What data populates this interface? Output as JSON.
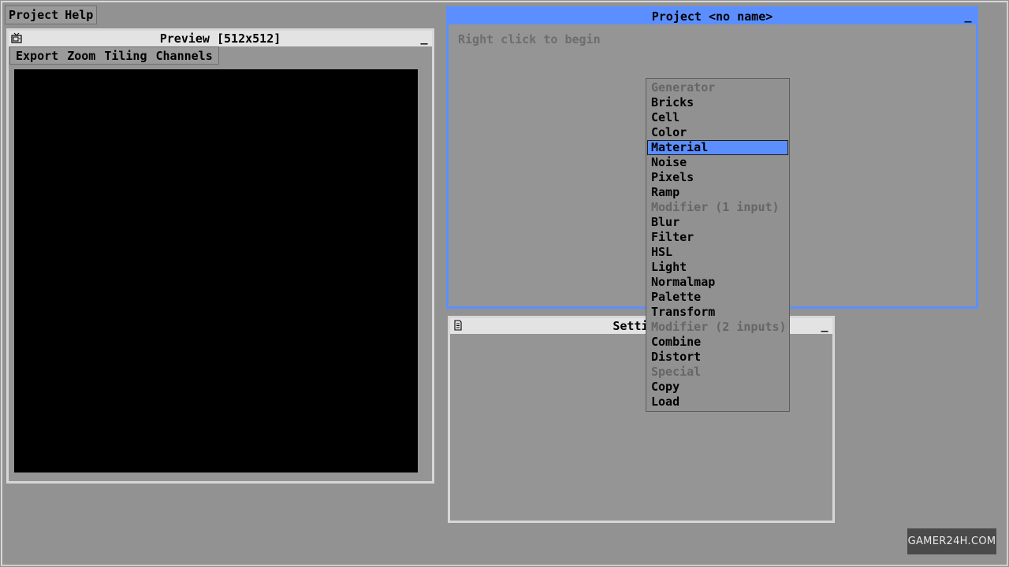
{
  "menubar": {
    "items": [
      "Project",
      "Help"
    ]
  },
  "preview": {
    "title": "Preview [512x512]",
    "icon": "tv-icon",
    "minimize_label": "_",
    "toolbar": [
      "Export",
      "Zoom",
      "Tiling",
      "Channels"
    ]
  },
  "project": {
    "title": "Project <no name>",
    "minimize_label": "_",
    "hint": "Right click to begin"
  },
  "settings": {
    "title": "Settings",
    "icon": "document-icon",
    "minimize_label": "_"
  },
  "context_menu": {
    "selected": "Material",
    "items": [
      {
        "label": "Generator",
        "header": true
      },
      {
        "label": "Bricks"
      },
      {
        "label": "Cell"
      },
      {
        "label": "Color"
      },
      {
        "label": "Material",
        "selected": true
      },
      {
        "label": "Noise"
      },
      {
        "label": "Pixels"
      },
      {
        "label": "Ramp"
      },
      {
        "label": "Modifier (1 input)",
        "header": true
      },
      {
        "label": "Blur"
      },
      {
        "label": "Filter"
      },
      {
        "label": "HSL"
      },
      {
        "label": "Light"
      },
      {
        "label": "Normalmap"
      },
      {
        "label": "Palette"
      },
      {
        "label": "Transform"
      },
      {
        "label": "Modifier (2 inputs)",
        "header": true
      },
      {
        "label": "Combine"
      },
      {
        "label": "Distort"
      },
      {
        "label": "Special",
        "header": true
      },
      {
        "label": "Copy"
      },
      {
        "label": "Load"
      }
    ]
  },
  "watermark": "GAMER24H.COM",
  "colors": {
    "accent": "#5b8fff",
    "background": "#929292",
    "canvas": "#000000"
  }
}
